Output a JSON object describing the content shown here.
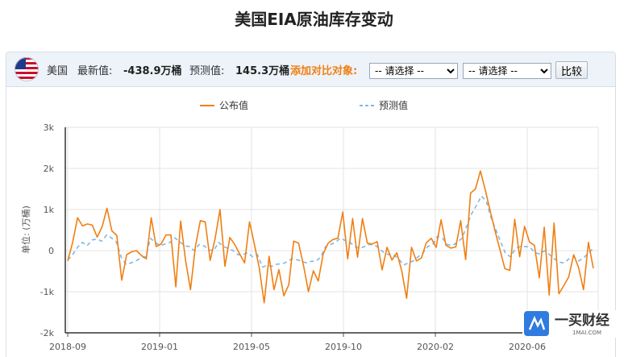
{
  "page": {
    "title": "美国EIA原油库存变动"
  },
  "toolbar": {
    "country": "美国",
    "latest_label": "最新值:",
    "latest_value": "-438.9万桶",
    "forecast_label": "预测值:",
    "forecast_value": "145.3万桶",
    "compare_label": "添加对比对象:",
    "select1_value": "-- 请选择 --",
    "select2_value": "-- 请选择 --",
    "compare_button": "比较",
    "icon": "us-flag-icon"
  },
  "logo": {
    "name": "一买财经",
    "url": "1MAI.COM"
  },
  "colors": {
    "actual": "#f07f13",
    "forecast": "#7fb8e6",
    "accent": "#f07f13"
  },
  "chart_data": {
    "type": "line",
    "ylabel": "单位: (万桶)",
    "ylim": [
      -2000,
      3000
    ],
    "yticks": [
      "-2k",
      "-1k",
      "0",
      "1k",
      "2k",
      "3k"
    ],
    "ytick_values": [
      -2000,
      -1000,
      0,
      1000,
      2000,
      3000
    ],
    "xticks": [
      "2018-09",
      "2019-01",
      "2019-05",
      "2019-10",
      "2020-02",
      "2020-06"
    ],
    "grid": true,
    "legend_position": "top",
    "series": [
      {
        "name": "公布值",
        "style": "solid",
        "values": [
          -250,
          200,
          800,
          600,
          650,
          620,
          330,
          580,
          1030,
          480,
          370,
          -720,
          -100,
          -30,
          0,
          -120,
          -200,
          800,
          100,
          160,
          380,
          380,
          -880,
          720,
          -240,
          -950,
          100,
          730,
          700,
          -240,
          290,
          1000,
          -380,
          320,
          150,
          -80,
          -300,
          700,
          150,
          -420,
          -1270,
          -140,
          -950,
          -460,
          -1100,
          -830,
          230,
          180,
          -360,
          -1000,
          -490,
          -740,
          -80,
          180,
          270,
          300,
          940,
          -200,
          780,
          -160,
          780,
          180,
          160,
          220,
          -470,
          80,
          -230,
          -50,
          -500,
          -1160,
          80,
          -250,
          -180,
          190,
          300,
          80,
          750,
          130,
          60,
          90,
          730,
          -220,
          1400,
          1500,
          1940,
          1480,
          970,
          480,
          20,
          -440,
          -480,
          760,
          -150,
          590,
          210,
          130,
          -660,
          570,
          -1080,
          670,
          -1050,
          -850,
          -640,
          -100,
          -410,
          -950,
          200,
          -430
        ],
        "show": "real"
      },
      {
        "name": "预测值",
        "style": "dashed",
        "values": [
          -230,
          -100,
          80,
          200,
          120,
          260,
          280,
          230,
          380,
          310,
          210,
          -160,
          -330,
          -300,
          -250,
          -180,
          -150,
          300,
          200,
          120,
          160,
          200,
          310,
          220,
          120,
          100,
          0,
          150,
          120,
          20,
          0,
          200,
          100,
          50,
          0,
          -100,
          -100,
          -50,
          -150,
          -100,
          -400,
          -360,
          -380,
          -330,
          -320,
          -280,
          -200,
          -220,
          -250,
          -300,
          -260,
          -260,
          -150,
          100,
          150,
          200,
          300,
          250,
          200,
          100,
          50,
          100,
          150,
          150,
          50,
          -50,
          -100,
          -100,
          -200,
          -350,
          -300,
          -250,
          -150,
          -50,
          100,
          150,
          350,
          300,
          150,
          120,
          200,
          300,
          600,
          900,
          1100,
          1330,
          1200,
          800,
          500,
          200,
          -80,
          -150,
          50,
          100,
          100,
          80,
          -50,
          -80,
          0,
          -100,
          -200,
          -280,
          -300,
          -200,
          -150,
          -250,
          -180,
          -50,
          50
        ]
      }
    ]
  }
}
